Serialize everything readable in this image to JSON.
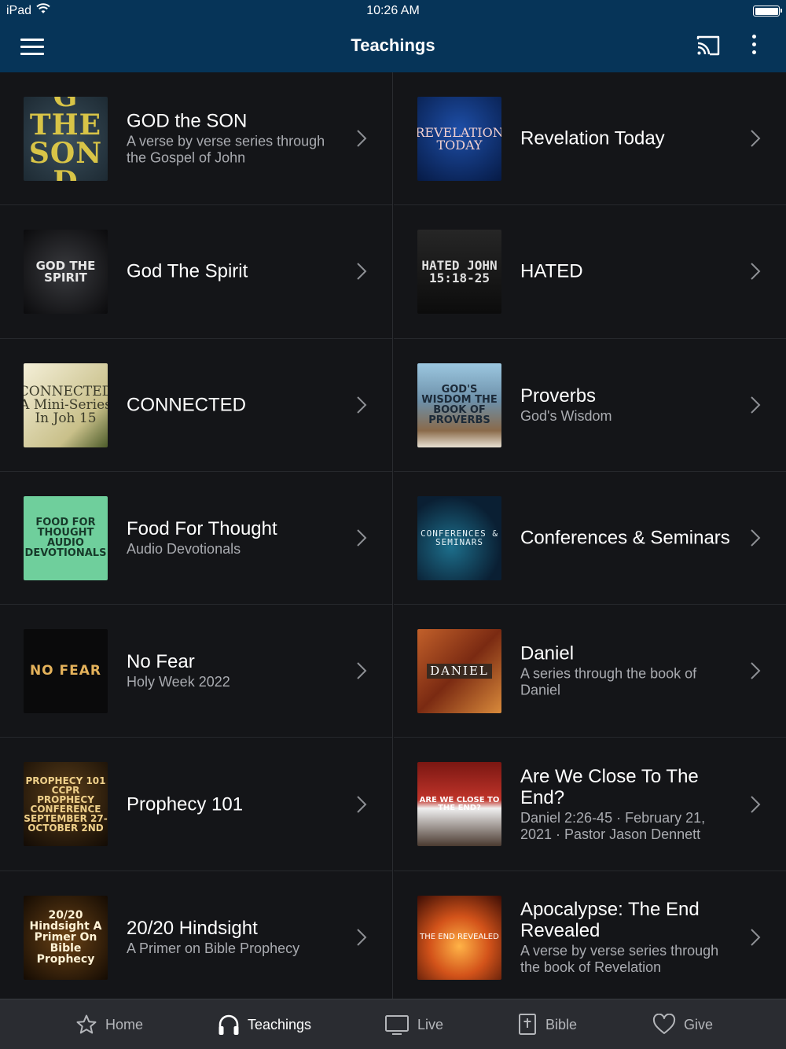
{
  "status_bar": {
    "carrier": "iPad",
    "time": "10:26 AM"
  },
  "header": {
    "title": "Teachings"
  },
  "left_items": [
    {
      "title": "GOD the SON",
      "subtitle": "A verse by verse series through the Gospel of John",
      "art_text": "G THE SON D"
    },
    {
      "title": "God The Spirit",
      "subtitle": "",
      "art_text": "GOD THE SPIRIT"
    },
    {
      "title": "CONNECTED",
      "subtitle": "",
      "art_text": "CONNECTED A Mini-Series In Joh 15"
    },
    {
      "title": "Food For Thought",
      "subtitle": "Audio Devotionals",
      "art_text": "FOOD FOR THOUGHT AUDIO DEVOTIONALS"
    },
    {
      "title": "No Fear",
      "subtitle": "Holy Week 2022",
      "art_text": "NO FEAR"
    },
    {
      "title": "Prophecy 101",
      "subtitle": "",
      "art_text": "PROPHECY 101 CCPR PROPHECY CONFERENCE SEPTEMBER 27-OCTOBER 2ND"
    },
    {
      "title": "20/20 Hindsight",
      "subtitle": "A Primer on Bible Prophecy",
      "art_text": "20/20 Hindsight A Primer On Bible Prophecy"
    }
  ],
  "right_items": [
    {
      "title": "Revelation Today",
      "subtitle": "",
      "art_text": "REVELATION TODAY"
    },
    {
      "title": "HATED",
      "subtitle": "",
      "art_text": "HATED JOHN 15:18-25"
    },
    {
      "title": "Proverbs",
      "subtitle": "God's Wisdom",
      "art_text": "GOD'S WISDOM THE BOOK OF PROVERBS"
    },
    {
      "title": "Conferences & Seminars",
      "subtitle": "",
      "art_text": "CONFERENCES & SEMINARS"
    },
    {
      "title": "Daniel",
      "subtitle": "A series through the book of Daniel",
      "art_text": "DANIEL"
    },
    {
      "title": "Are We Close To The End?",
      "subtitle": "Daniel 2:26-45 · February 21, 2021 · Pastor Jason Dennett",
      "art_text": "ARE WE CLOSE TO THE END?"
    },
    {
      "title": "Apocalypse: The End Revealed",
      "subtitle": "A verse by verse series through the book of Revelation",
      "art_text": "THE END REVEALED"
    }
  ],
  "tabs": [
    {
      "label": "Home",
      "icon": "star-icon"
    },
    {
      "label": "Teachings",
      "icon": "headphones-icon"
    },
    {
      "label": "Live",
      "icon": "monitor-icon"
    },
    {
      "label": "Bible",
      "icon": "bible-icon"
    },
    {
      "label": "Give",
      "icon": "heart-icon"
    }
  ],
  "colors": {
    "header": "#063458",
    "background": "#141518",
    "tabbar": "#2a2c31",
    "subtitle": "#a9abb0"
  }
}
